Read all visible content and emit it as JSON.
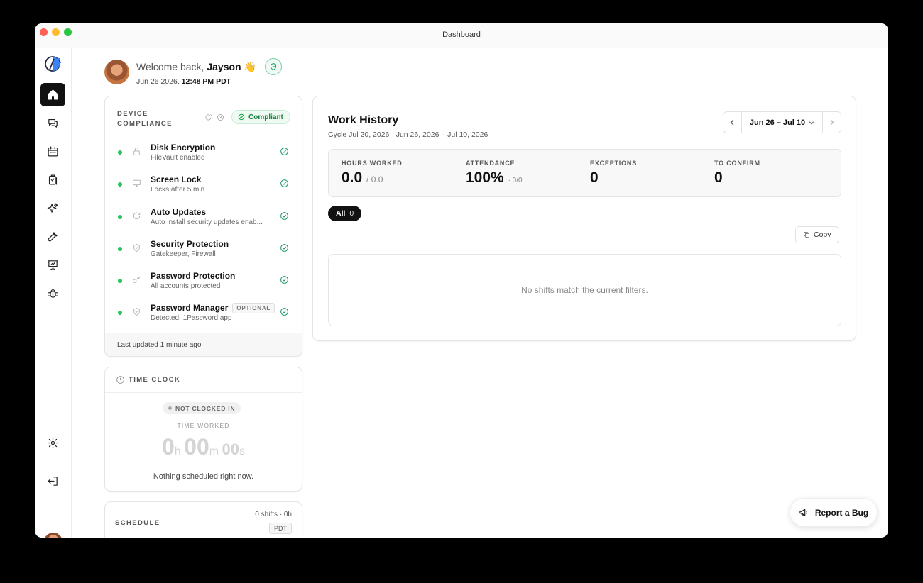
{
  "window": {
    "title": "Dashboard"
  },
  "sidebar": {
    "items": [
      {
        "icon": "home-icon"
      },
      {
        "icon": "messages-icon"
      },
      {
        "icon": "calendar-icon"
      },
      {
        "icon": "clipboard-icon"
      },
      {
        "icon": "sparkles-icon"
      },
      {
        "icon": "wrench-icon"
      },
      {
        "icon": "presentation-chart-icon"
      },
      {
        "icon": "bug-icon"
      }
    ],
    "bottom": [
      {
        "icon": "gear-icon"
      },
      {
        "icon": "logout-icon"
      }
    ]
  },
  "header": {
    "welcome_prefix": "Welcome back,",
    "user_name": "Jayson",
    "wave": "👋",
    "date": "Jun 26 2026,",
    "time": "12:48 PM PDT"
  },
  "compliance": {
    "title": "DEVICE COMPLIANCE",
    "status": "Compliant",
    "items": [
      {
        "name": "Disk Encryption",
        "detail": "FileVault enabled",
        "icon": "lock-icon"
      },
      {
        "name": "Screen Lock",
        "detail": "Locks after 5 min",
        "icon": "monitor-icon"
      },
      {
        "name": "Auto Updates",
        "detail": "Auto install security updates enab...",
        "icon": "refresh-icon"
      },
      {
        "name": "Security Protection",
        "detail": "Gatekeeper, Firewall",
        "icon": "shield-icon"
      },
      {
        "name": "Password Protection",
        "detail": "All accounts protected",
        "icon": "key-icon"
      },
      {
        "name": "Password Manager",
        "detail": "Detected: 1Password.app",
        "icon": "shield-icon",
        "badge": "OPTIONAL"
      }
    ],
    "footer": "Last updated 1 minute ago"
  },
  "time_clock": {
    "title": "TIME CLOCK",
    "status": "NOT CLOCKED IN",
    "worked_label": "TIME WORKED",
    "hours": "0",
    "h_unit": "h",
    "minutes": "00",
    "m_unit": "m",
    "seconds": "00",
    "s_unit": "s",
    "message": "Nothing scheduled right now."
  },
  "schedule": {
    "title": "SCHEDULE",
    "count": "0 shifts · 0h",
    "timezone": "PDT"
  },
  "work_history": {
    "title": "Work History",
    "cycle": "Cycle Jul 20, 2026 · Jun 26, 2026 – Jul 10, 2026",
    "range": "Jun 26 – Jul 10",
    "stats": [
      {
        "label": "HOURS WORKED",
        "value": "0.0",
        "sub": "/ 0.0"
      },
      {
        "label": "ATTENDANCE",
        "value": "100%",
        "sub": "· 0/0"
      },
      {
        "label": "EXCEPTIONS",
        "value": "0",
        "sub": ""
      },
      {
        "label": "TO CONFIRM",
        "value": "0",
        "sub": ""
      }
    ],
    "filter_label": "All",
    "filter_count": "0",
    "copy_label": "Copy",
    "empty_message": "No shifts match the current filters."
  },
  "report_bug": {
    "label": "Report a Bug"
  },
  "colors": {
    "accent": "#111111",
    "success": "#22c55e",
    "compliant_text": "#15803d"
  }
}
